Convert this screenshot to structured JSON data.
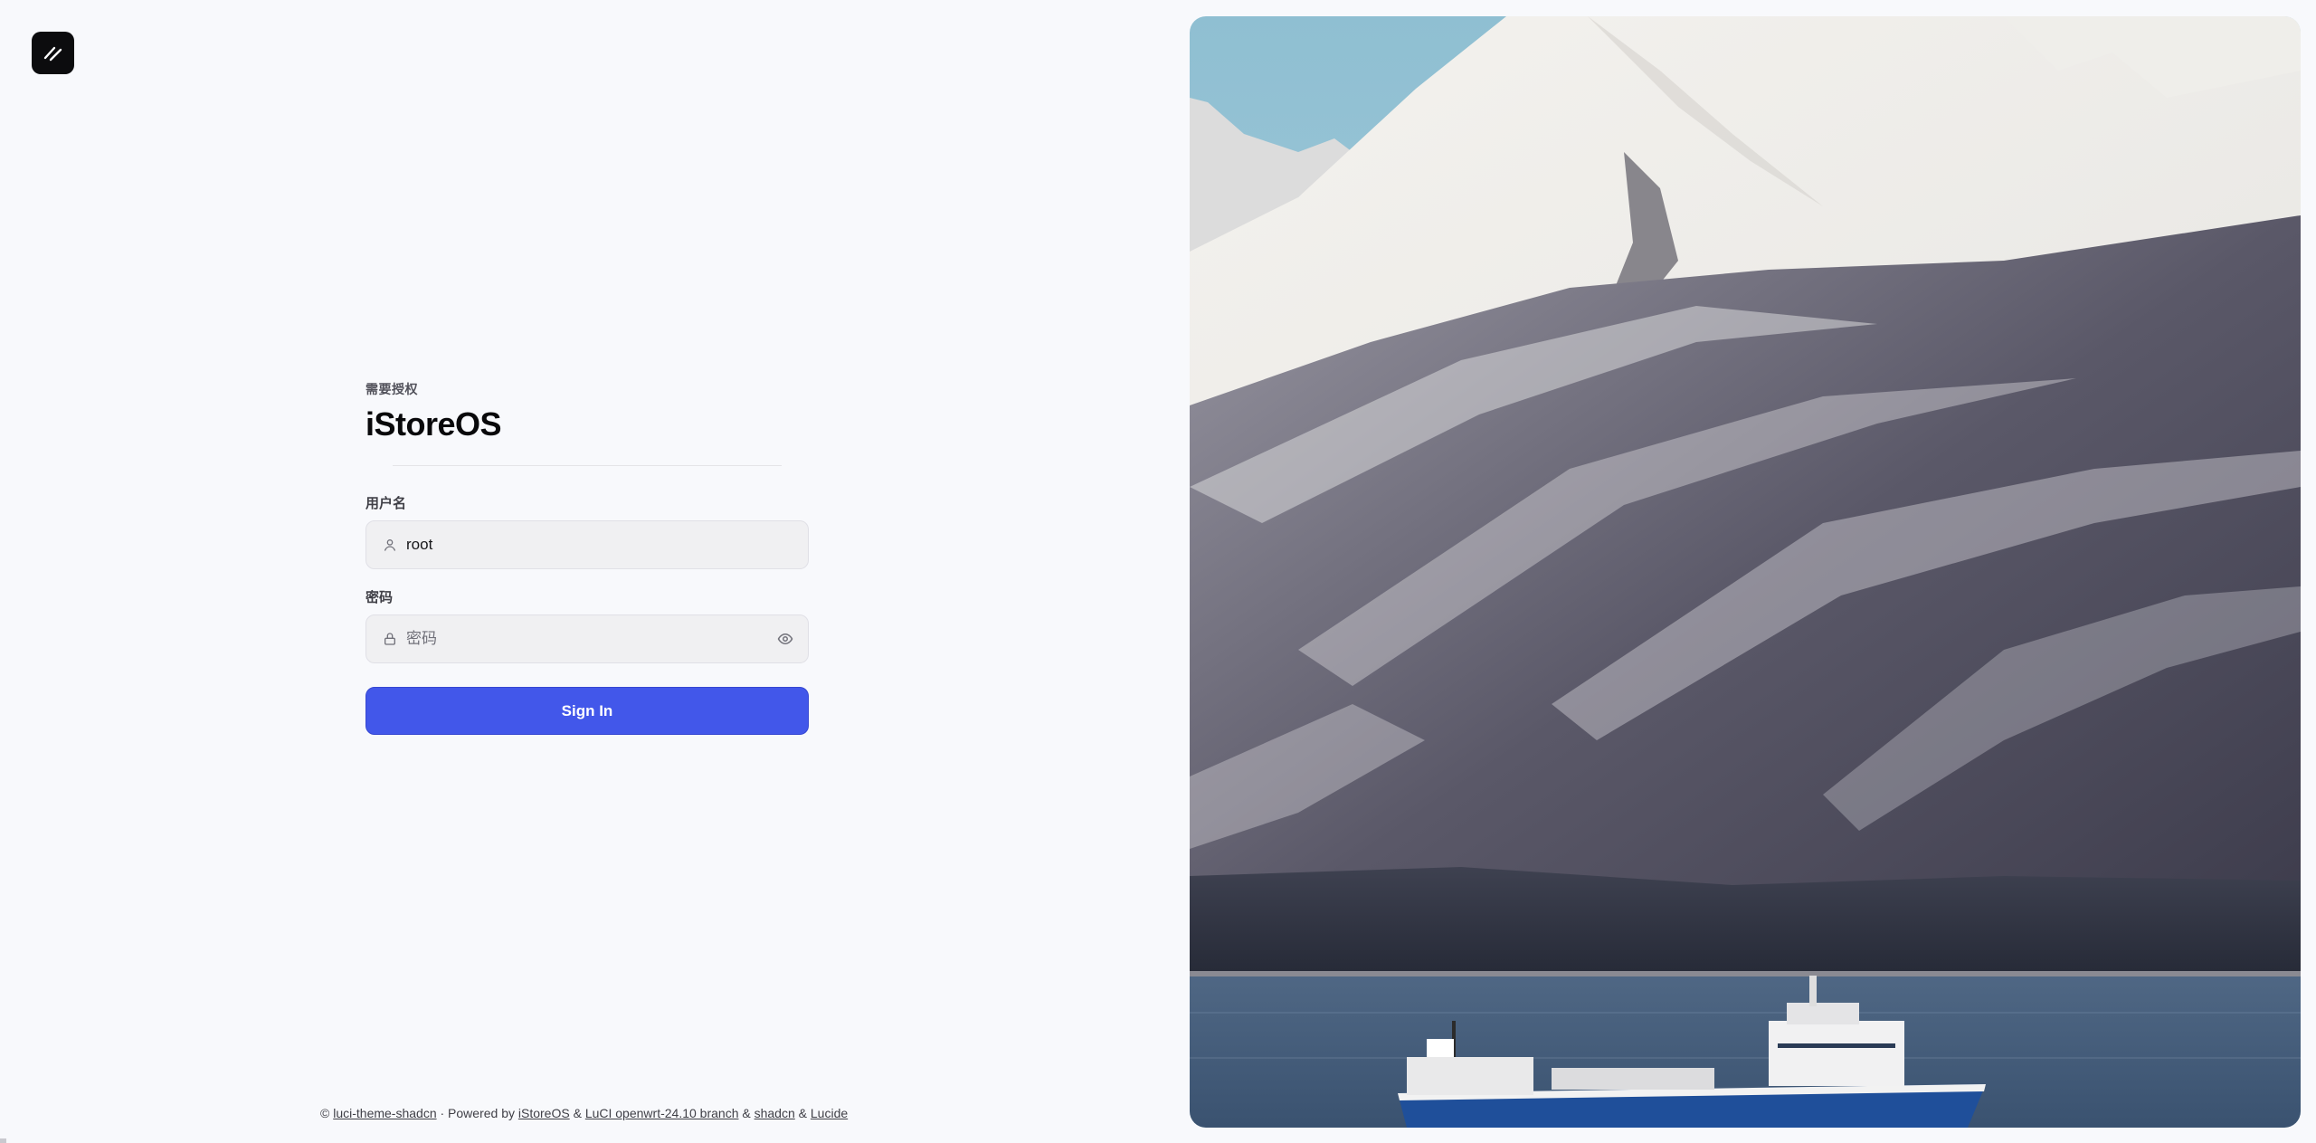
{
  "header": {
    "logo_icon": "slash-logo-icon"
  },
  "login": {
    "eyebrow": "需要授权",
    "brand": "iStoreOS",
    "username_label": "用户名",
    "username_value": "root",
    "username_icon": "user-icon",
    "password_label": "密码",
    "password_placeholder": "密码",
    "password_icon": "lock-icon",
    "toggle_visibility_icon": "eye-icon",
    "signin_label": "Sign In",
    "accent_color": "#4257ea"
  },
  "footer": {
    "copyright": "©",
    "theme_link": "luci-theme-shadcn",
    "powered_by": "· Powered by",
    "istoreos_link": "iStoreOS",
    "amp1": "&",
    "luci_link": "LuCI openwrt-24.10 branch",
    "amp2": "&",
    "shadcn_link": "shadcn",
    "amp3": "&",
    "lucide_link": "Lucide"
  },
  "hero": {
    "image_subject": "snowy-mountain-fjord-with-ship"
  }
}
